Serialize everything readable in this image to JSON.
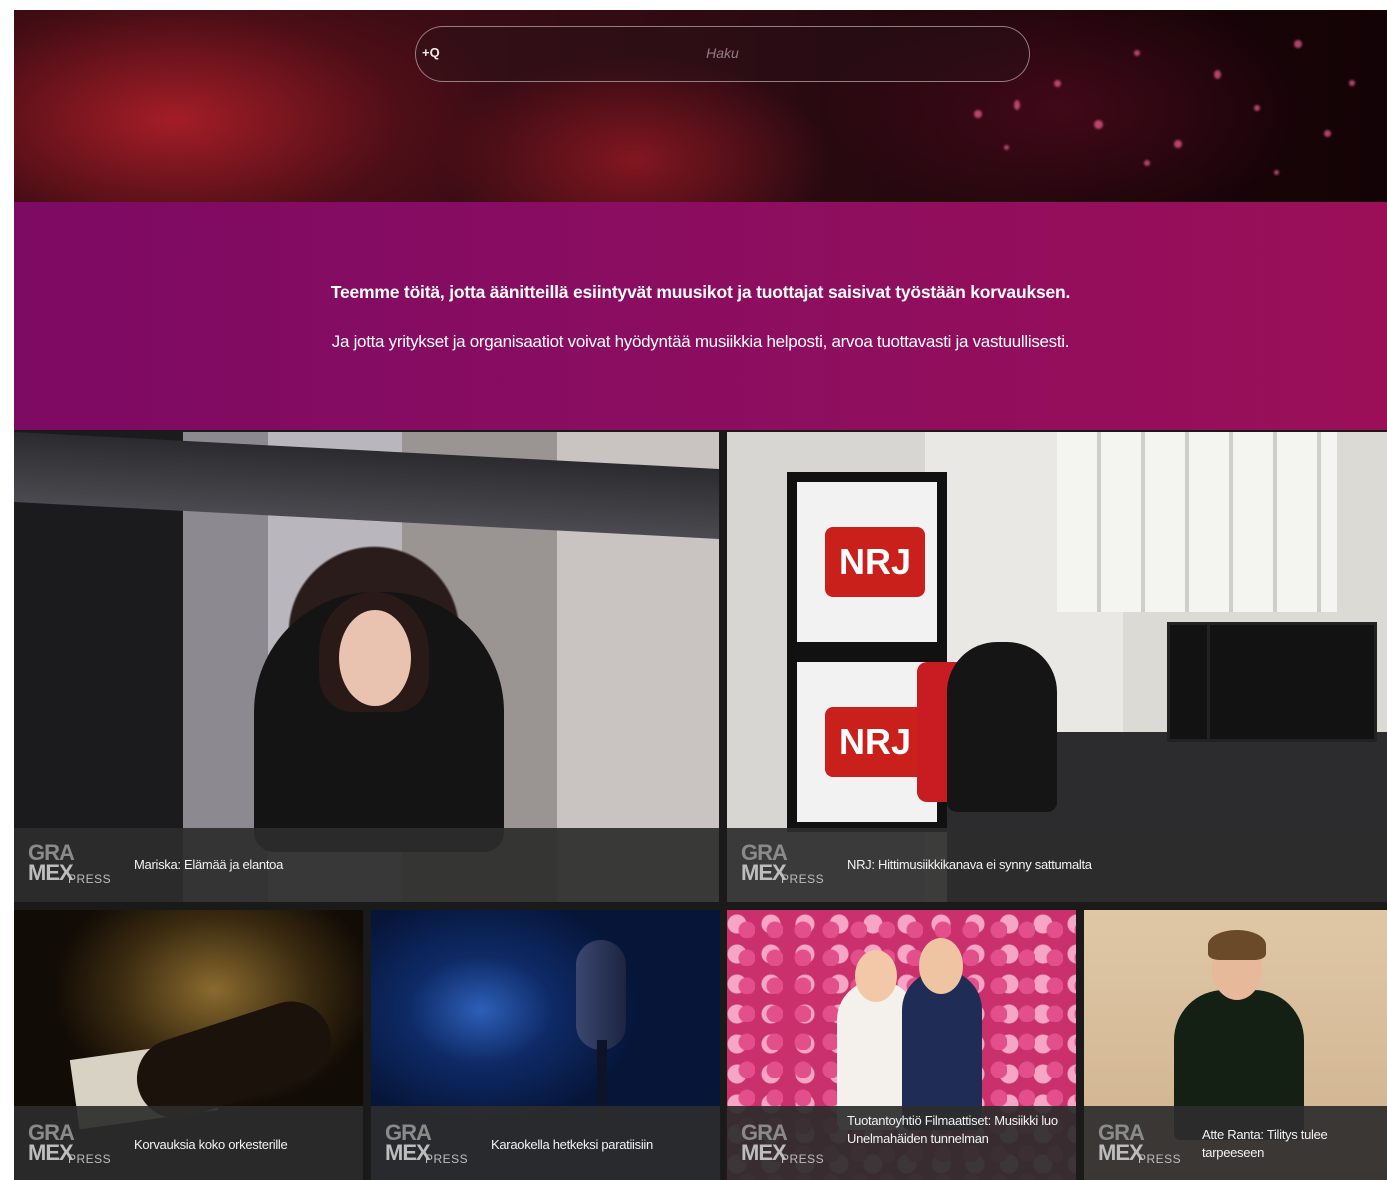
{
  "search": {
    "placeholder": "Haku",
    "icon": "search-icon"
  },
  "mission": {
    "line1": "Teemme töitä, jotta äänitteillä esiintyvät muusikot ja tuottajat saisivat työstään korvauksen.",
    "line2": "Ja jotta yritykset ja organisaatiot voivat hyödyntää musiikkia helposti, arvoa tuottavasti ja vastuullisesti."
  },
  "logo": {
    "gra": "GRA",
    "mex": "MEX",
    "press": "PRESS"
  },
  "articles": [
    {
      "title": "Mariska: Elämää ja elantoa"
    },
    {
      "title": "NRJ: Hittimusiikkikanava ei synny sattumalta"
    },
    {
      "title": "Korvauksia koko orkesterille"
    },
    {
      "title": "Karaokella hetkeksi paratiisiin"
    },
    {
      "title": "Tuotantoyhtiö Filmaattiset: Musiikki luo Unelmahäiden tunnelman"
    },
    {
      "title": "Atte Ranta: Tilitys tulee tarpeeseen"
    }
  ],
  "poster": {
    "brand": "NRJ"
  }
}
